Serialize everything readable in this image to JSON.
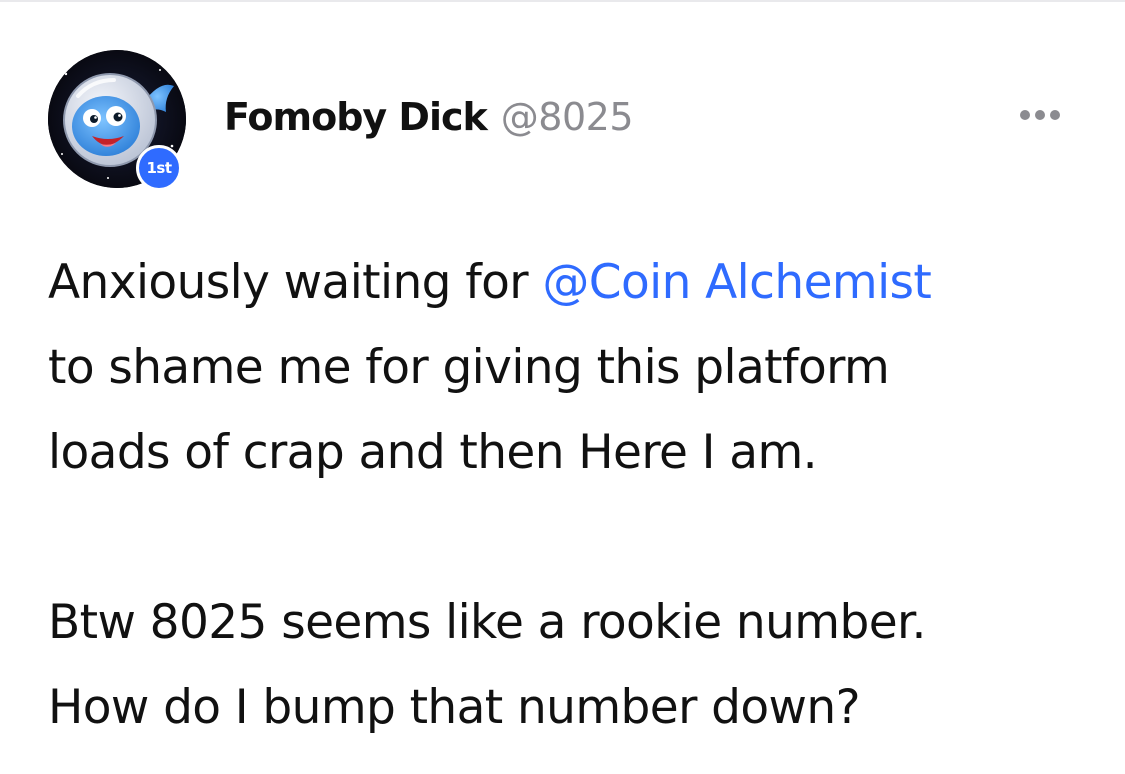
{
  "post": {
    "author": {
      "name": "Fomoby Dick",
      "handle": "@8025",
      "avatar_icon": "whale-astronaut-avatar",
      "rank_badge": "1st"
    },
    "more_icon": "ellipsis-icon",
    "body": {
      "paragraph1": {
        "line1_prefix": "Anxiously waiting for ",
        "mention": "@Coin Alchemist",
        "line2": "to shame me for giving this platform",
        "line3": "loads of crap and then Here I am."
      },
      "paragraph2": {
        "line1": "Btw 8025 seems like a rookie number.",
        "line2": "How do I bump that number down?"
      }
    }
  },
  "colors": {
    "accent": "#2f6bff",
    "text": "#111111",
    "muted": "#8b8b90",
    "background": "#ffffff"
  }
}
